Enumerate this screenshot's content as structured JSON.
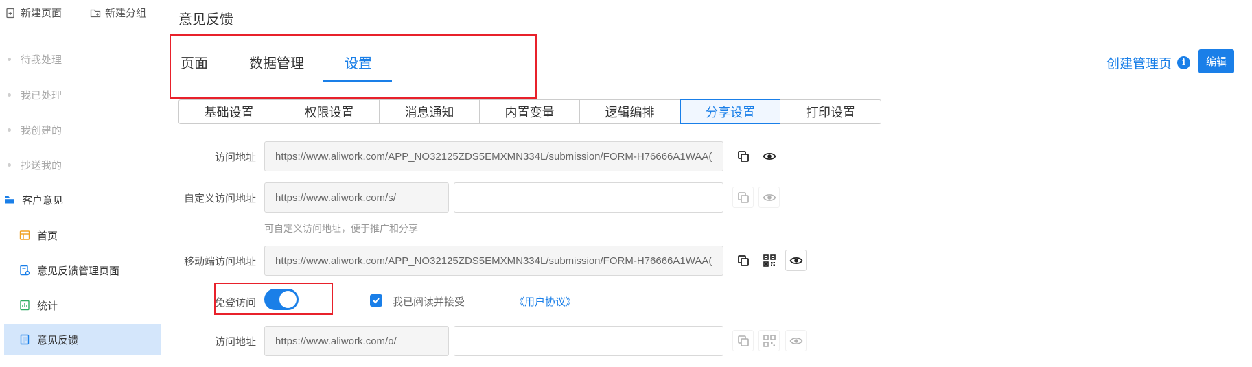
{
  "sidebar": {
    "new_page": "新建页面",
    "new_group": "新建分组",
    "nav_items": [
      {
        "label": "待我处理"
      },
      {
        "label": "我已处理"
      },
      {
        "label": "我创建的"
      },
      {
        "label": "抄送我的"
      }
    ],
    "group": {
      "label": "客户意见"
    },
    "pages": [
      {
        "label": "首页",
        "icon": "layout-icon"
      },
      {
        "label": "意见反馈管理页面",
        "icon": "manage-page-icon"
      },
      {
        "label": "统计",
        "icon": "chart-icon"
      },
      {
        "label": "意见反馈",
        "icon": "form-icon",
        "active": true
      }
    ]
  },
  "header": {
    "title": "意见反馈",
    "tabs": [
      {
        "label": "页面"
      },
      {
        "label": "数据管理"
      },
      {
        "label": "设置",
        "active": true
      }
    ],
    "create_link": "创建管理页",
    "edit_button": "编辑"
  },
  "subtabs": [
    {
      "label": "基础设置"
    },
    {
      "label": "权限设置"
    },
    {
      "label": "消息通知"
    },
    {
      "label": "内置变量"
    },
    {
      "label": "逻辑编排"
    },
    {
      "label": "分享设置",
      "active": true
    },
    {
      "label": "打印设置"
    }
  ],
  "form": {
    "access_url": {
      "label": "访问地址",
      "value": "https://www.aliwork.com/APP_NO32125ZDS5EMXMN334L/submission/FORM-H76666A1WAA("
    },
    "custom_url": {
      "label": "自定义访问地址",
      "prefix": "https://www.aliwork.com/s/",
      "value": "",
      "hint": "可自定义访问地址，便于推广和分享"
    },
    "mobile_url": {
      "label": "移动端访问地址",
      "value": "https://www.aliwork.com/APP_NO32125ZDS5EMXMN334L/submission/FORM-H76666A1WAA("
    },
    "login_free": {
      "label": "免登访问",
      "enabled": true,
      "agree_text": "我已阅读并接受",
      "agreement_link": "《用户协议》",
      "agreed": true
    },
    "public_url": {
      "label": "访问地址",
      "prefix": "https://www.aliwork.com/o/",
      "value": ""
    }
  },
  "colors": {
    "accent": "#1a7fe8",
    "highlight": "#e8212b",
    "active_sidebar": "#d4e6fb"
  }
}
